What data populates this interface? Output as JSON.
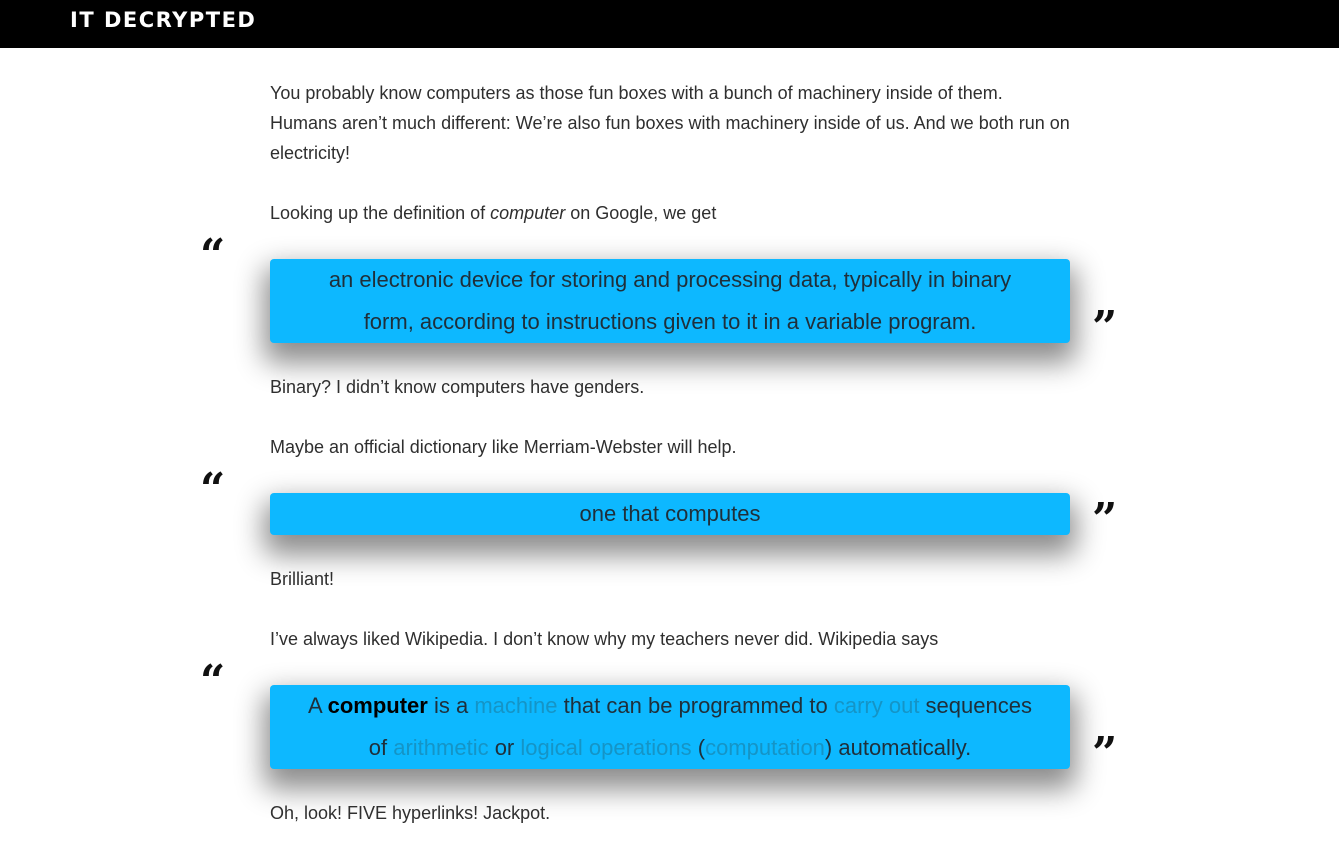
{
  "header": {
    "brand": "IT DECRYPTED"
  },
  "quote_marks": {
    "open": "“",
    "close": "”"
  },
  "article": {
    "p1": "You probably know computers as those fun boxes with a bunch of machinery inside of them. Humans aren’t much different: We’re also fun boxes with machinery inside of us. And we both run on electricity!",
    "p2": {
      "before": "Looking up the definition of ",
      "emph": "computer",
      "after": " on Google, we get"
    },
    "quote1": "an electronic device for storing and processing data, typically in binary form, according to instructions given to it in a variable program.",
    "p3": "Binary? I didn’t know computers have genders.",
    "p4": "Maybe an official dictionary like Merriam-Webster will help.",
    "quote2": "one that computes",
    "p5": "Brilliant!",
    "p6": "I’ve always liked Wikipedia. I don’t know why my teachers never did. Wikipedia says",
    "quote3": {
      "t1": "A ",
      "bold": "computer",
      "t2": " is a ",
      "link1": "machine",
      "t3": " that can be programmed to ",
      "link2": "carry out",
      "t4": " sequences of ",
      "link3": "arithmetic",
      "t5": " or ",
      "link4": "logical operations",
      "t6": " (",
      "link5": "computation",
      "t7": ") automatically."
    },
    "p7": "Oh, look! FIVE hyperlinks! Jackpot."
  },
  "colors": {
    "quote_bg": "#0db8ff",
    "link": "#1594c6",
    "header_bg": "#000000"
  }
}
